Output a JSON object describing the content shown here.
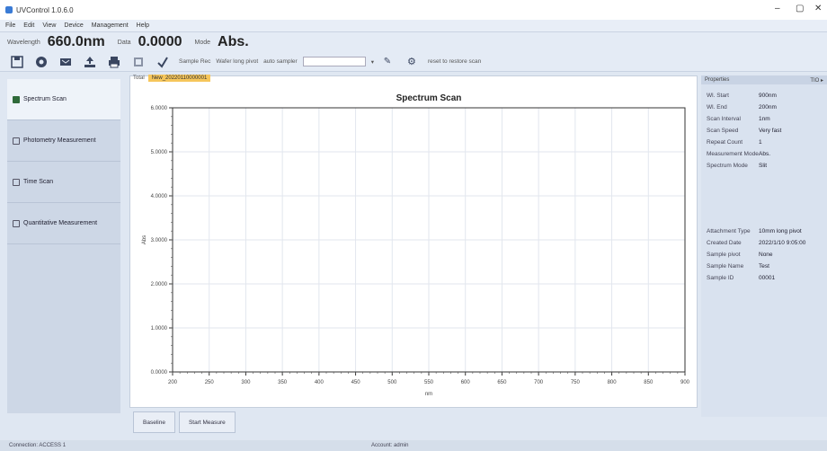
{
  "window": {
    "title": "UVControl 1.0.6.0",
    "controls": [
      "–",
      "▢",
      "✕"
    ]
  },
  "menu": [
    "File",
    "Edit",
    "View",
    "Device",
    "Management",
    "Help"
  ],
  "readout": {
    "wavelength_label": "Wavelength",
    "wavelength_value": "660.0nm",
    "data_label": "Data",
    "data_value": "0.0000",
    "mode_label": "Mode",
    "mode_value": "Abs."
  },
  "toolbar": {
    "icons": [
      "save-icon",
      "record-icon",
      "export-icon",
      "upload-icon",
      "print-icon",
      "settings-icon",
      "check-icon"
    ],
    "sample_label": "Sample Rec",
    "extra_label": "Wafer long pivot",
    "sample_select_label": "auto sampler",
    "tail_text": "reset  to  restore  scan"
  },
  "sidebar": {
    "items": [
      {
        "label": "Spectrum Scan",
        "icon": "spectrum-icon",
        "active": true
      },
      {
        "label": "Photometry Measurement",
        "icon": "photometry-icon",
        "active": false
      },
      {
        "label": "Time Scan",
        "icon": "time-icon",
        "active": false
      },
      {
        "label": "Quantitative Measurement",
        "icon": "quantitative-icon",
        "active": false
      }
    ]
  },
  "tabs": {
    "prefix": "Total",
    "active": "New_20220110000001"
  },
  "chart_data": {
    "type": "line",
    "title": "Spectrum Scan",
    "xlabel": "nm",
    "ylabel": "Abs",
    "xlim": [
      200,
      900
    ],
    "ylim": [
      0,
      6
    ],
    "x_ticks": [
      200,
      250,
      300,
      350,
      400,
      450,
      500,
      550,
      600,
      650,
      700,
      750,
      800,
      850,
      900
    ],
    "y_ticks": [
      "0.0000",
      "1.0000",
      "2.0000",
      "3.0000",
      "4.0000",
      "5.0000",
      "6.0000"
    ],
    "grid": true,
    "series": []
  },
  "properties": {
    "header": "Properties",
    "header_right": "TIO ▸",
    "rows": [
      {
        "k": "Wl. Start",
        "v": "900nm"
      },
      {
        "k": "Wl. End",
        "v": "200nm"
      },
      {
        "k": "Scan Interval",
        "v": "1nm"
      },
      {
        "k": "Scan Speed",
        "v": "Very fast"
      },
      {
        "k": "Repeat Count",
        "v": "1"
      },
      {
        "k": "Measurement Mode",
        "v": "Abs."
      },
      {
        "k": "Spectrum Mode",
        "v": "Slit"
      }
    ],
    "rows2": [
      {
        "k": "Attachment Type",
        "v": "10mm long pivot"
      },
      {
        "k": "Created Date",
        "v": "2022/1/10 9:05:00"
      },
      {
        "k": "Sample pivot",
        "v": "None"
      },
      {
        "k": "Sample Name",
        "v": "Test"
      },
      {
        "k": "Sample ID",
        "v": "00001"
      }
    ]
  },
  "buttons": {
    "baseline": "Baseline",
    "start": "Start Measure"
  },
  "status": {
    "left": "Connection: ACCESS 1",
    "center": "Account: admin"
  }
}
